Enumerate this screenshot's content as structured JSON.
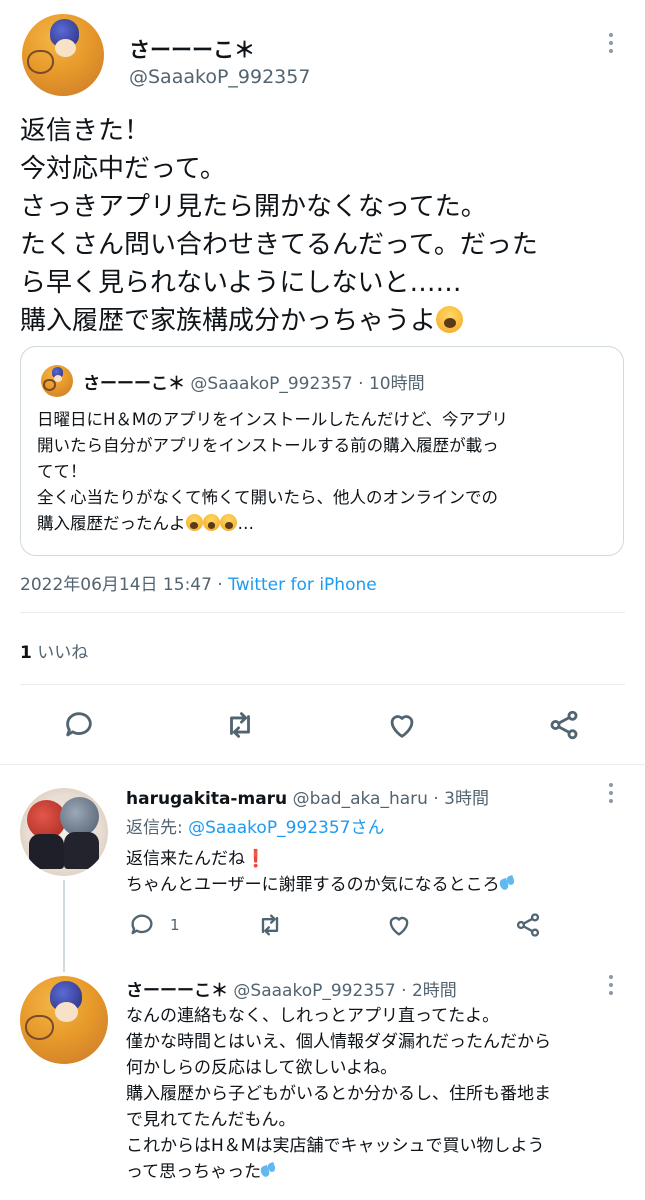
{
  "main_tweet": {
    "display_name": "さーーーこ＊",
    "handle": "@SaaakoP_992357",
    "body_lines": [
      "返信きた！",
      "今対応中だって。",
      "さっきアプリ見たら開かなくなってた。",
      "たくさん問い合わせきてるんだって。だった",
      "ら早く見られないようにしないと……",
      "購入履歴で家族構成分かっちゃうよ"
    ],
    "timestamp": "2022年06月14日 15:47",
    "separator": "·",
    "source": "Twitter for iPhone",
    "likes_count": "1",
    "likes_label": "いいね"
  },
  "quoted_tweet": {
    "display_name": "さーーーこ＊",
    "handle": "@SaaakoP_992357",
    "separator": "·",
    "time": "10時間",
    "body_lines": [
      "日曜日にH＆Mのアプリをインストールしたんだけど、今アプリ",
      "開いたら自分がアプリをインストールする前の購入履歴が載っ",
      "てて！",
      "全く心当たりがなくて怖くて開いたら、他人のオンラインでの",
      "購入履歴だったんよ"
    ],
    "trailing": "…"
  },
  "reply_1": {
    "display_name": "harugakita-maru",
    "handle": "@bad_aka_haru",
    "separator": "·",
    "time": "3時間",
    "reply_to_prefix": "返信先:",
    "reply_to_handle": "@SaaakoP_992357さん",
    "body_lines": [
      "返信来たんだね",
      "ちゃんとユーザーに謝罪するのか気になるところ"
    ],
    "reply_count": "1"
  },
  "reply_2": {
    "display_name": "さーーーこ＊",
    "handle": "@SaaakoP_992357",
    "separator": "·",
    "time": "2時間",
    "body_lines": [
      "なんの連絡もなく、しれっとアプリ直ってたよ。",
      "僅かな時間とはいえ、個人情報ダダ漏れだったんだから",
      "何かしらの反応はして欲しいよね。",
      "購入履歴から子どもがいるとか分かるし、住所も番地ま",
      "で見れてたんだもん。",
      "これからはH＆Mは実店舗でキャッシュで買い物しよう",
      "って思っちゃった"
    ]
  },
  "colors": {
    "text": "#0f1419",
    "muted": "#536471",
    "link": "#1d9bf0",
    "divider": "#e6ecf0"
  },
  "icons": {
    "reply": "comment-bubble-icon",
    "retweet": "retweet-arrows-icon",
    "like": "heart-icon",
    "share": "share-nodes-icon",
    "more": "vertical-ellipsis-icon"
  }
}
